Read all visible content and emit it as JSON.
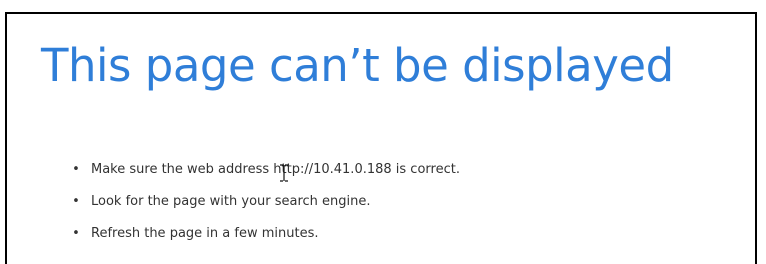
{
  "page": {
    "title": "This page can’t be displayed",
    "bullet_glyph": "•",
    "tips": [
      "Make sure the web address http://10.41.0.188 is correct.",
      "Look for the page with your search engine.",
      "Refresh the page in a few minutes."
    ]
  },
  "colors": {
    "title": "#2f7ed8",
    "body_text": "#333333"
  },
  "cursor": {
    "icon": "text-cursor-icon"
  }
}
